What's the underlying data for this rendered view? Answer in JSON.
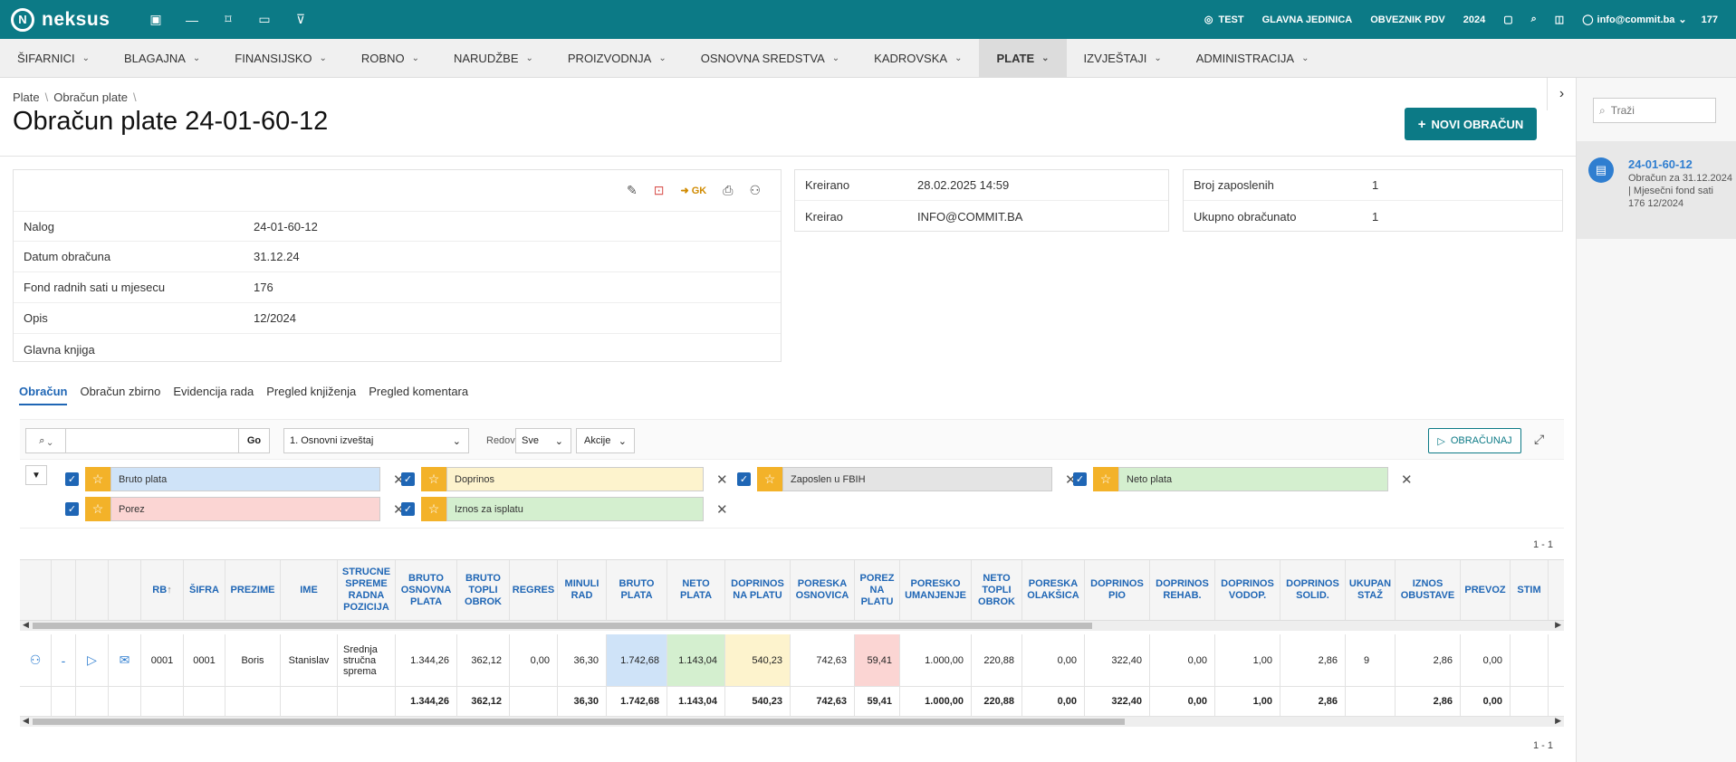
{
  "app": {
    "logo_text": "neksus",
    "right": {
      "env": "TEST",
      "unit": "GLAVNA JEDINICA",
      "vat": "OBVEZNIK PDV",
      "year": "2024",
      "user": "info@commit.ba",
      "count": "177"
    }
  },
  "menu": [
    {
      "label": "ŠIFARNICI"
    },
    {
      "label": "BLAGAJNA"
    },
    {
      "label": "FINANSIJSKO"
    },
    {
      "label": "ROBNO"
    },
    {
      "label": "NARUDŽBE"
    },
    {
      "label": "PROIZVODNJA"
    },
    {
      "label": "OSNOVNA SREDSTVA"
    },
    {
      "label": "KADROVSKA"
    },
    {
      "label": "PLATE"
    },
    {
      "label": "IZVJEŠTAJI"
    },
    {
      "label": "ADMINISTRACIJA"
    }
  ],
  "breadcrumb": [
    "Plate",
    "Obračun plate"
  ],
  "page_title": "Obračun plate 24-01-60-12",
  "new_button": "NOVI OBRAČUN",
  "side": {
    "search_placeholder": "Traži",
    "card_title": "24-01-60-12",
    "card_desc": "Obračun za 31.12.2024 | Mjesečni fond sati 176 12/2024"
  },
  "details": {
    "gk": "GK",
    "rows": [
      {
        "label": "Nalog",
        "value": "24-01-60-12"
      },
      {
        "label": "Datum obračuna",
        "value": "31.12.24"
      },
      {
        "label": "Fond radnih sati u mjesecu",
        "value": "176"
      },
      {
        "label": "Opis",
        "value": "12/2024"
      },
      {
        "label": "Glavna knjiga",
        "value": ""
      }
    ]
  },
  "created": {
    "rows": [
      {
        "label": "Kreirano",
        "value": "28.02.2025 14:59"
      },
      {
        "label": "Kreirao",
        "value": "INFO@COMMIT.BA"
      }
    ]
  },
  "summary": {
    "rows": [
      {
        "label": "Broj zaposlenih",
        "value": "1"
      },
      {
        "label": "Ukupno obračunato",
        "value": "1"
      }
    ]
  },
  "tabs": [
    "Obračun",
    "Obračun zbirno",
    "Evidencija rada",
    "Pregled knjiženja",
    "Pregled komentara"
  ],
  "toolbar": {
    "go": "Go",
    "report": "1. Osnovni izveštaj",
    "rows_label": "Redovi",
    "rows_value": "Sve",
    "actions": "Akcije",
    "calc": "OBRAČUNAJ"
  },
  "filters": [
    {
      "label": "Bruto plata",
      "color": "#cfe3f8"
    },
    {
      "label": "Doprinos",
      "color": "#fdf3cd"
    },
    {
      "label": "Zaposlen u FBIH",
      "color": "#e4e4e4"
    },
    {
      "label": "Neto plata",
      "color": "#d4efcf"
    },
    {
      "label": "Porez",
      "color": "#fbd5d3"
    },
    {
      "label": "Iznos za isplatu",
      "color": "#d4efcf"
    }
  ],
  "pager": "1 - 1",
  "grid": {
    "headers": [
      "",
      "",
      "",
      "",
      "RB",
      "ŠIFRA",
      "PREZIME",
      "IME",
      "STRUCNE SPREME RADNA POZICIJA",
      "BRUTO OSNOVNA PLATA",
      "BRUTO TOPLI OBROK",
      "REGRES",
      "MINULI RAD",
      "BRUTO PLATA",
      "NETO PLATA",
      "DOPRINOS NA PLATU",
      "PORESKA OSNOVICA",
      "POREZ NA PLATU",
      "PORESKO UMANJENJE",
      "NETO TOPLI OBROK",
      "PORESKA OLAKŠICA",
      "DOPRINOS PIO",
      "DOPRINOS REHAB.",
      "DOPRINOS VODOP.",
      "DOPRINOS SOLID.",
      "UKUPAN STAŽ",
      "IZNOS OBUSTAVE",
      "PREVOZ",
      "STIM"
    ],
    "row": [
      "",
      "-",
      "",
      "",
      "0001",
      "0001",
      "Boris",
      "Stanislav",
      "Srednja stručna sprema",
      "1.344,26",
      "362,12",
      "0,00",
      "36,30",
      "1.742,68",
      "1.143,04",
      "540,23",
      "742,63",
      "59,41",
      "1.000,00",
      "220,88",
      "0,00",
      "322,40",
      "0,00",
      "1,00",
      "2,86",
      "9",
      "2,86",
      "0,00",
      ""
    ],
    "totals": [
      "",
      "",
      "",
      "",
      "",
      "",
      "",
      "",
      "",
      "1.344,26",
      "362,12",
      "",
      "36,30",
      "1.742,68",
      "1.143,04",
      "540,23",
      "742,63",
      "59,41",
      "1.000,00",
      "220,88",
      "0,00",
      "322,40",
      "0,00",
      "1,00",
      "2,86",
      "",
      "2,86",
      "0,00",
      ""
    ]
  }
}
